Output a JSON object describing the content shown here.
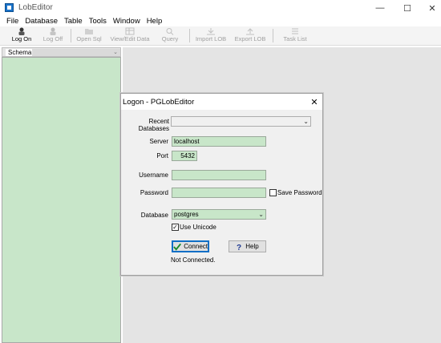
{
  "window": {
    "title": "LobEditor"
  },
  "menu": [
    "File",
    "Database",
    "Table",
    "Tools",
    "Window",
    "Help"
  ],
  "toolbar": {
    "log_on": "Log On",
    "log_off": "Log Off",
    "open_sql": "Open Sql",
    "view_edit": "View/Edit Data",
    "query": "Query",
    "import_lob": "Import LOB",
    "export_lob": "Export LOB",
    "task_list": "Task List"
  },
  "schema": {
    "label": "Schema"
  },
  "dialog": {
    "title": "Logon - PGLobEditor",
    "recent_databases_label": "Recent Databases",
    "recent_databases_value": "",
    "server_label": "Server",
    "server_value": "localhost",
    "port_label": "Port",
    "port_value": "5432",
    "username_label": "Username",
    "username_value": "",
    "password_label": "Password",
    "password_value": "",
    "save_password_label": "Save Password",
    "save_password_checked": false,
    "database_label": "Database",
    "database_value": "postgres",
    "use_unicode_label": "Use Unicode",
    "use_unicode_checked": true,
    "connect_label": "Connect",
    "help_label": "Help",
    "status": "Not Connected."
  },
  "colors": {
    "field_bg": "#c8e6c9",
    "workspace_bg": "#e4e4e4",
    "accent": "#0f6fc6"
  }
}
